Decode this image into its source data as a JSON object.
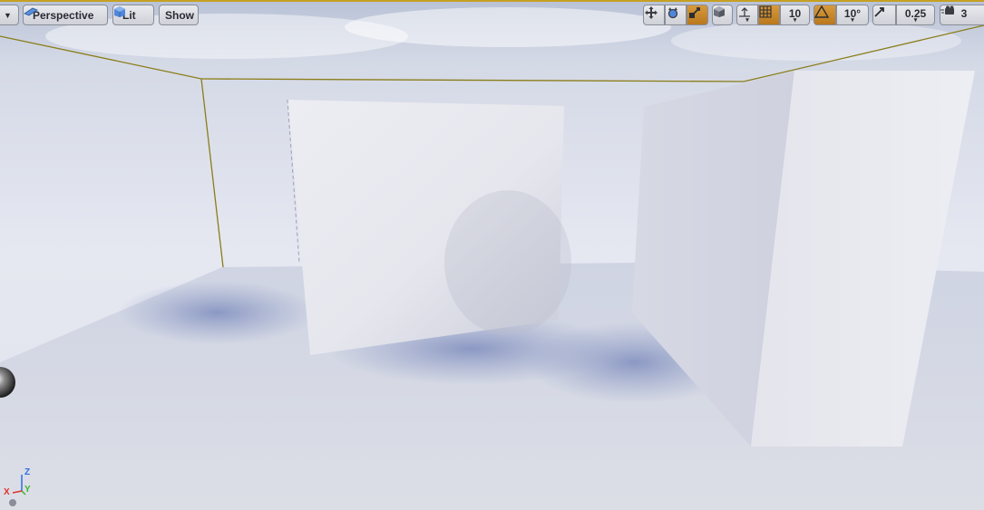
{
  "toolbar": {
    "options_dropdown_label": "",
    "view_mode_label": "Perspective",
    "lighting_mode_label": "Lit",
    "show_label": "Show"
  },
  "snapping": {
    "grid_snap_value": "10",
    "rotation_snap_value": "10°",
    "scale_snap_value": "0.25",
    "camera_speed_value": "3"
  },
  "icons": {
    "perspective": "perspective-camera-icon",
    "lit": "lit-cube-icon",
    "translate": "translate-arrows-icon",
    "rotate": "rotate-icon",
    "scale": "scale-icon",
    "world_local": "world-cube-icon",
    "surface_snap": "surface-snap-icon",
    "grid": "grid-icon",
    "angle": "angle-snap-icon",
    "scale_snap": "scale-snap-icon",
    "camera_speed": "camera-speed-icon"
  },
  "axis_gizmo": {
    "z": "Z",
    "y": "Y",
    "x": "X"
  },
  "colors": {
    "accent_active": "#c8852a",
    "selection_outline": "#8a7d18",
    "axis_x": "#e0322e",
    "axis_y": "#3fb52c",
    "axis_z": "#2f6fe0"
  }
}
